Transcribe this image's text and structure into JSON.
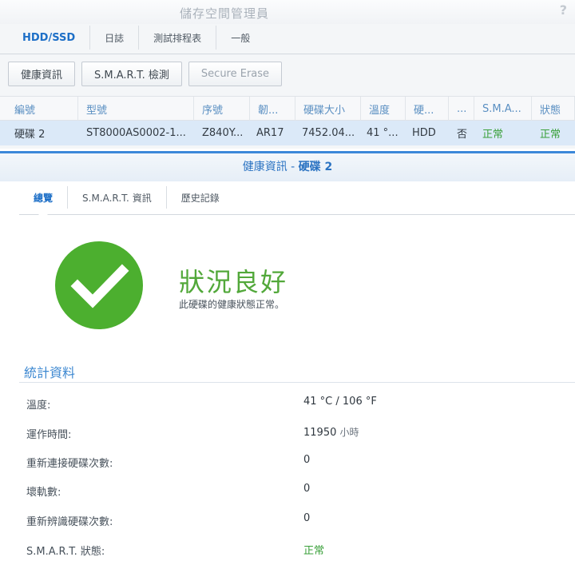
{
  "window": {
    "title": "儲存空間管理員",
    "help_icon": "?"
  },
  "main_tabs": [
    {
      "label": "HDD/SSD"
    },
    {
      "label": "日誌"
    },
    {
      "label": "測試排程表"
    },
    {
      "label": "一般"
    }
  ],
  "toolbar": {
    "health_info": "健康資訊",
    "smart_test": "S.M.A.R.T. 檢測",
    "secure_erase": "Secure Erase"
  },
  "table": {
    "columns": [
      "編號",
      "型號",
      "序號",
      "韌...",
      "硬碟大小",
      "溫度",
      "硬...",
      "...",
      "S.M.A...",
      "狀態"
    ],
    "row": [
      "硬碟 2",
      "ST8000AS0002-1...",
      "Z840Y...",
      "AR17",
      "7452.04...",
      "41 °...",
      "HDD",
      "否",
      "正常",
      "正常"
    ]
  },
  "panel": {
    "title_prefix": "健康資訊 - ",
    "title_disk": "硬碟 2",
    "tabs": [
      {
        "label": "總覽"
      },
      {
        "label": "S.M.A.R.T. 資訊"
      },
      {
        "label": "歷史記錄"
      }
    ],
    "status_heading": "狀況良好",
    "status_description": "此硬碟的健康狀態正常。",
    "stats_title": "統計資料",
    "stats": [
      {
        "label": "溫度:",
        "value": "41 °C / 106 °F",
        "unit": ""
      },
      {
        "label": "運作時間:",
        "value": "11950",
        "unit": "小時"
      },
      {
        "label": "重新連接硬碟次數:",
        "value": "0",
        "unit": ""
      },
      {
        "label": "壞軌數:",
        "value": "0",
        "unit": ""
      },
      {
        "label": "重新辨識硬碟次數:",
        "value": "0",
        "unit": ""
      },
      {
        "label": "S.M.A.R.T. 狀態:",
        "value": "正常",
        "unit": ""
      }
    ]
  },
  "colors": {
    "accent": "#1d6fc7",
    "ok_green": "#52a83a",
    "selected_row": "#dbe9f8"
  }
}
